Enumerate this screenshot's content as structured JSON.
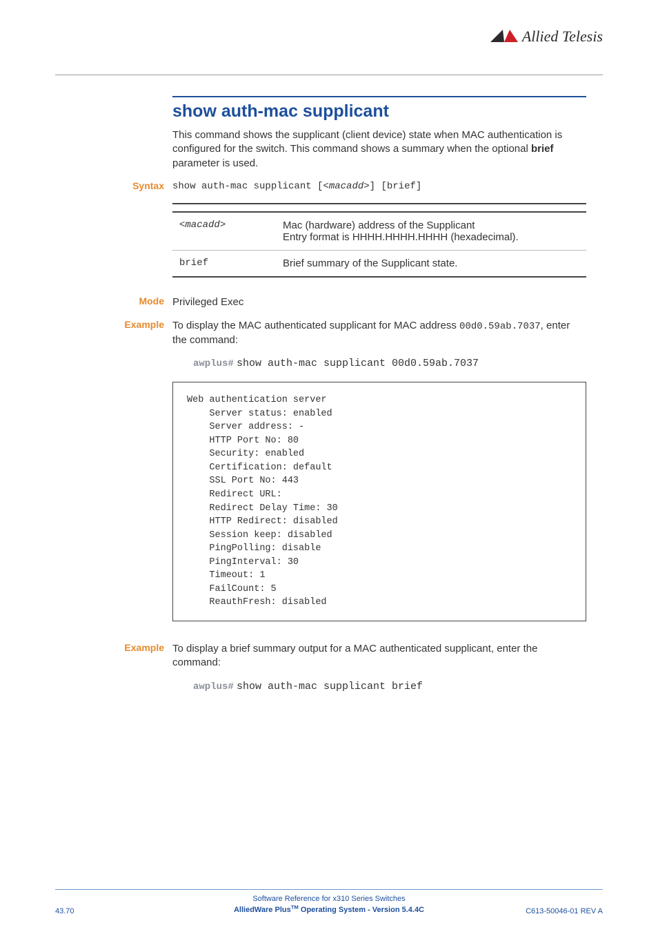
{
  "logo": {
    "text": "Allied Telesis"
  },
  "title": "show auth-mac supplicant",
  "intro_pre": "This command shows the supplicant (client device) state when MAC authentication is configured for the switch. This command shows a summary when the optional ",
  "intro_bold": "brief",
  "intro_post": " parameter is used.",
  "labels": {
    "syntax": "Syntax",
    "mode": "Mode",
    "example1": "Example",
    "example2": "Example"
  },
  "syntax": {
    "cmd_a": "show auth-mac supplicant [<",
    "cmd_param": "macadd",
    "cmd_b": ">] [brief]"
  },
  "params": [
    {
      "key_pre": "<",
      "key_mid": "macadd",
      "key_post": ">",
      "desc_l1": "Mac (hardware) address of the Supplicant",
      "desc_l2": "Entry format is HHHH.HHHH.HHHH (hexadecimal)."
    },
    {
      "key": "brief",
      "desc": "Brief summary of the Supplicant state."
    }
  ],
  "mode_value": "Privileged Exec",
  "example1": {
    "text_a": "To display the MAC authenticated supplicant for MAC address ",
    "mac": "00d0.59ab.7037",
    "text_b": ", enter the command:",
    "prompt": "awplus#",
    "cmd": "show auth-mac supplicant 00d0.59ab.7037"
  },
  "output": "Web authentication server\n    Server status: enabled\n    Server address: -\n    HTTP Port No: 80\n    Security: enabled\n    Certification: default\n    SSL Port No: 443\n    Redirect URL:\n    Redirect Delay Time: 30\n    HTTP Redirect: disabled\n    Session keep: disabled\n    PingPolling: disable\n    PingInterval: 30\n    Timeout: 1\n    FailCount: 5\n    ReauthFresh: disabled",
  "example2": {
    "text": "To display a brief summary output for a MAC authenticated supplicant, enter the command:",
    "prompt": "awplus#",
    "cmd": "show auth-mac supplicant brief"
  },
  "footer": {
    "line1": "Software Reference for x310 Series Switches",
    "line2_a": "AlliedWare Plus",
    "line2_tm": "TM",
    "line2_b": " Operating System  - Version 5.4.4C",
    "left": "43.70",
    "right": "C613-50046-01 REV A"
  }
}
